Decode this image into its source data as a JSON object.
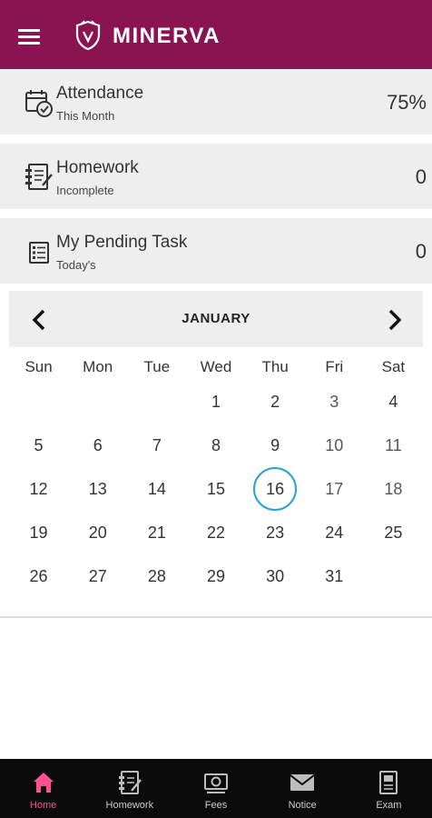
{
  "app": {
    "name": "MINERVA",
    "brand_color": "#8a1351"
  },
  "header": {
    "menu_icon": "hamburger-icon",
    "logo_icon": "shield-logo-icon"
  },
  "cards": [
    {
      "id": "attendance",
      "icon": "calendar-check-icon",
      "title": "Attendance",
      "subtitle": "This Month",
      "value": "75%"
    },
    {
      "id": "homework",
      "icon": "notebook-icon",
      "title": "Homework",
      "subtitle": "Incomplete",
      "value": "0"
    },
    {
      "id": "pending",
      "icon": "checklist-icon",
      "title": "My Pending Task",
      "subtitle": "Today's",
      "value": "0"
    }
  ],
  "calendar": {
    "month": "JANUARY",
    "weekdays": [
      "Sun",
      "Mon",
      "Tue",
      "Wed",
      "Thu",
      "Fri",
      "Sat"
    ],
    "weeks": [
      [
        "",
        "",
        "",
        "1",
        "2",
        "3",
        "4"
      ],
      [
        "5",
        "6",
        "7",
        "8",
        "9",
        "10",
        "11"
      ],
      [
        "12",
        "13",
        "14",
        "15",
        "16",
        "17",
        "18"
      ],
      [
        "19",
        "20",
        "21",
        "22",
        "23",
        "24",
        "25"
      ],
      [
        "26",
        "27",
        "28",
        "29",
        "30",
        "31",
        ""
      ]
    ],
    "today": "16",
    "today_ring_color": "#2a9fd8"
  },
  "bottom_nav": {
    "active_color": "#ff4f96",
    "items": [
      {
        "label": "Home",
        "icon": "home-icon",
        "active": true
      },
      {
        "label": "Homework",
        "icon": "homework-icon",
        "active": false
      },
      {
        "label": "Fees",
        "icon": "fees-icon",
        "active": false
      },
      {
        "label": "Notice",
        "icon": "mail-icon",
        "active": false
      },
      {
        "label": "Exam",
        "icon": "exam-icon",
        "active": false
      }
    ]
  }
}
